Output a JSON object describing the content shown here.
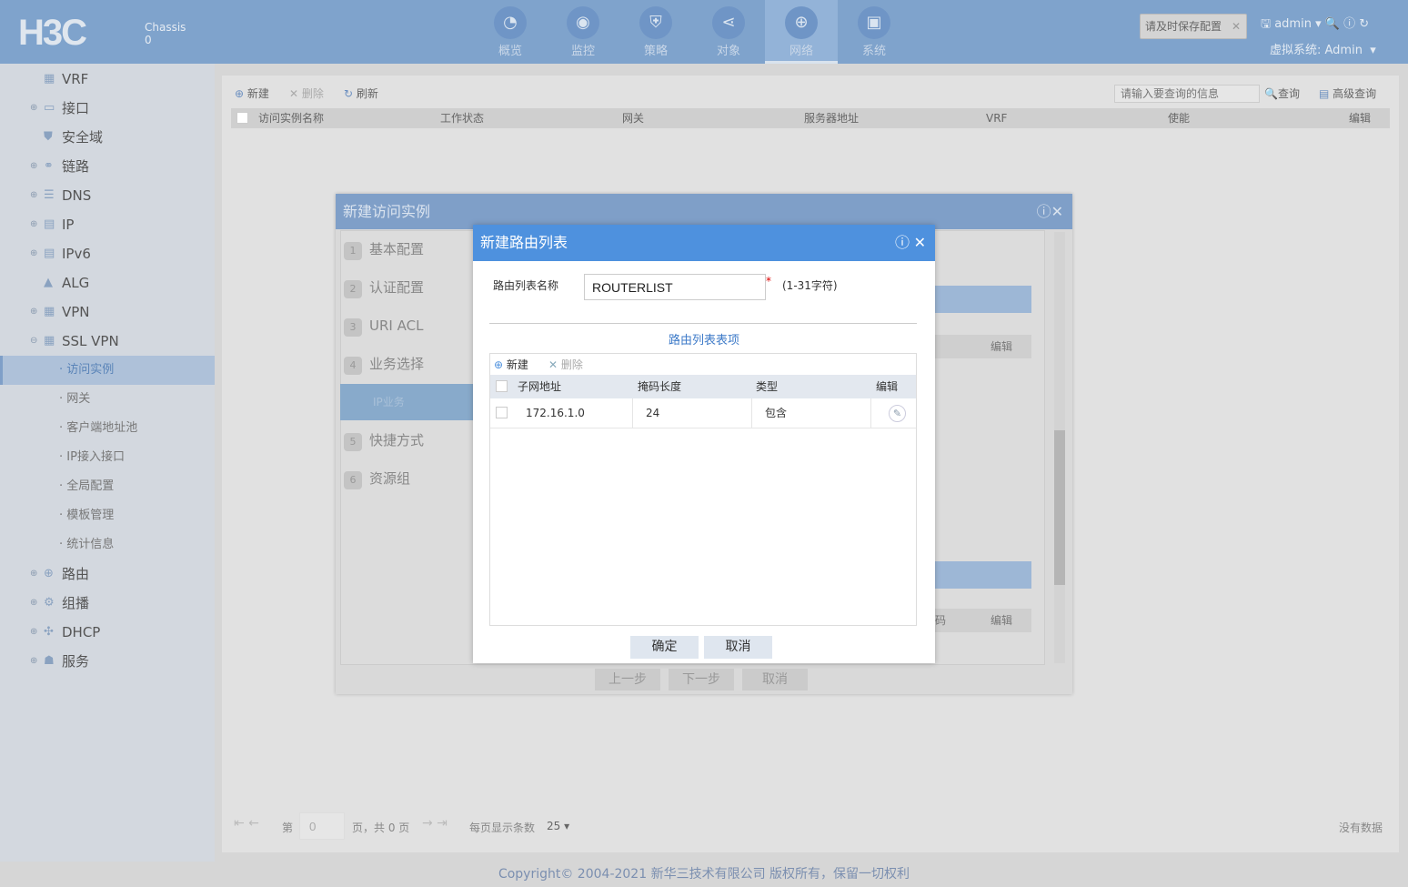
{
  "header": {
    "logo": "H3C",
    "chassis_label": "Chassis",
    "chassis_value": "0",
    "nav": [
      {
        "label": "概览",
        "icon": "dashboard-icon"
      },
      {
        "label": "监控",
        "icon": "monitor-icon"
      },
      {
        "label": "策略",
        "icon": "shield-icon"
      },
      {
        "label": "对象",
        "icon": "share-icon"
      },
      {
        "label": "网络",
        "icon": "globe-icon",
        "active": true
      },
      {
        "label": "系统",
        "icon": "system-icon"
      }
    ],
    "save_tip": "请及时保存配置",
    "user": "admin",
    "virtual_system": "虚拟系统: Admin"
  },
  "sidebar": {
    "items": [
      {
        "label": "VRF"
      },
      {
        "label": "接口"
      },
      {
        "label": "安全域"
      },
      {
        "label": "链路"
      },
      {
        "label": "DNS"
      },
      {
        "label": "IP"
      },
      {
        "label": "IPv6"
      },
      {
        "label": "ALG"
      },
      {
        "label": "VPN"
      },
      {
        "label": "SSL VPN"
      }
    ],
    "sub_items": [
      "访问实例",
      "网关",
      "客户端地址池",
      "IP接入接口",
      "全局配置",
      "模板管理",
      "统计信息"
    ],
    "items2": [
      "路由",
      "组播",
      "DHCP",
      "服务"
    ]
  },
  "main": {
    "toolbar": {
      "new": "新建",
      "delete": "删除",
      "refresh": "刷新",
      "search_placeholder": "请输入要查询的信息",
      "query": "查询",
      "advanced": "高级查询"
    },
    "columns": [
      "访问实例名称",
      "工作状态",
      "网关",
      "服务器地址",
      "VRF",
      "使能",
      "编辑"
    ],
    "pagination": {
      "page_prefix": "第",
      "page": "0",
      "page_suffix": "页，共 0 页",
      "per_page_label": "每页显示条数",
      "per_page": "25",
      "no_data": "没有数据"
    }
  },
  "outer_dialog": {
    "title": "新建访问实例",
    "steps": [
      {
        "n": "1",
        "label": "基本配置"
      },
      {
        "n": "2",
        "label": "认证配置"
      },
      {
        "n": "3",
        "label": "URI ACL"
      },
      {
        "n": "4",
        "label": "业务选择"
      },
      {
        "n": "",
        "label": "IP业务"
      },
      {
        "n": "5",
        "label": "快捷方式"
      },
      {
        "n": "6",
        "label": "资源组"
      }
    ],
    "edit1": "编辑",
    "edit2": "编辑",
    "partial": "码",
    "prev": "上一步",
    "next": "下一步",
    "cancel": "取消"
  },
  "inner_dialog": {
    "title": "新建路由列表",
    "name_label": "路由列表名称",
    "name_value": "ROUTERLIST",
    "required": "*",
    "hint": "(1-31字符)",
    "section": "路由列表表项",
    "new": "新建",
    "delete": "删除",
    "columns": [
      "子网地址",
      "掩码长度",
      "类型",
      "编辑"
    ],
    "rows": [
      {
        "subnet": "172.16.1.0",
        "mask": "24",
        "type": "包含"
      }
    ],
    "ok": "确定",
    "cancel": "取消"
  },
  "footer": "Copyright© 2004-2021 新华三技术有限公司 版权所有，保留一切权利"
}
